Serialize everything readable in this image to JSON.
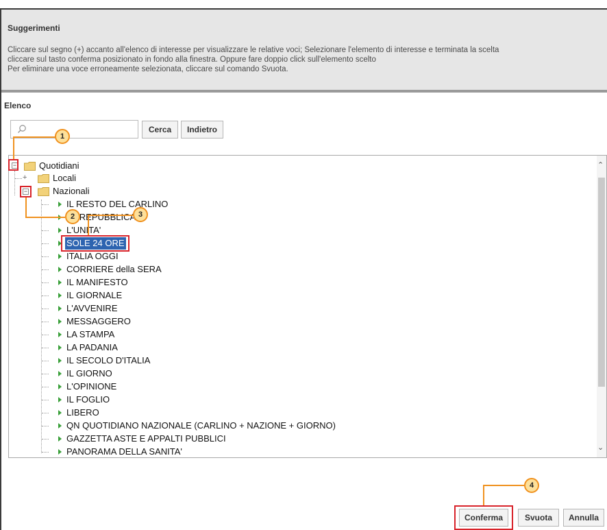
{
  "suggestions": {
    "title": "Suggerimenti",
    "lines": [
      "Cliccare sul segno (+) accanto all'elenco di interesse per visualizzare le relative voci; Selezionare l'elemento di interesse e terminata la scelta",
      "cliccare sul tasto conferma posizionato in fondo alla finestra. Oppure fare doppio click sull'elemento scelto",
      "Per eliminare una voce erroneamente selezionata, cliccare sul comando Svuota."
    ]
  },
  "elenco_label": "Elenco",
  "search": {
    "value": "",
    "placeholder": ""
  },
  "buttons": {
    "cerca": "Cerca",
    "indietro": "Indietro",
    "conferma": "Conferma",
    "svuota": "Svuota",
    "annulla": "Annulla"
  },
  "tree": {
    "root": "Quotidiani",
    "locali": "Locali",
    "nazionali": "Nazionali",
    "selected": "SOLE 24 ORE",
    "items": [
      "IL RESTO DEL CARLINO",
      "LA REPUBBLICA",
      "L'UNITA'",
      "SOLE 24 ORE",
      "ITALIA OGGI",
      "CORRIERE della SERA",
      "IL MANIFESTO",
      "IL GIORNALE",
      "L'AVVENIRE",
      "MESSAGGERO",
      "LA STAMPA",
      "LA PADANIA",
      "IL SECOLO D'ITALIA",
      "IL GIORNO",
      "L'OPINIONE",
      "IL FOGLIO",
      "LIBERO",
      "QN QUOTIDIANO NAZIONALE (CARLINO + NAZIONE + GIORNO)",
      "GAZZETTA ASTE E APPALTI PUBBLICI",
      "PANORAMA DELLA SANITA'"
    ]
  },
  "callouts": [
    "1",
    "2",
    "3",
    "4"
  ],
  "colors": {
    "highlight": "#d8232a",
    "callout_line": "#f0911e",
    "callout_fill": "#fde09a",
    "selection": "#2d64b0",
    "leaf_arrow": "#3aa03a"
  }
}
